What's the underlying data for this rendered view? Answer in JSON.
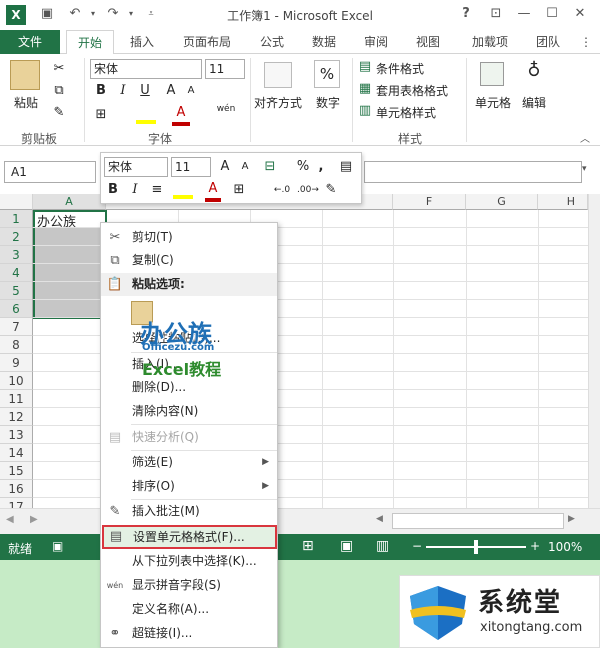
{
  "window": {
    "title": "工作簿1 - Microsoft Excel",
    "help": "?"
  },
  "ribbon_tabs": [
    "开始",
    "插入",
    "页面布局",
    "公式",
    "数据",
    "审阅",
    "视图",
    "加载项",
    "团队"
  ],
  "file_tab": "文件",
  "ribbon": {
    "clipboard": {
      "paste": "粘贴",
      "group": "剪贴板"
    },
    "font": {
      "name": "宋体",
      "size": "11",
      "group": "字体",
      "bold": "B",
      "italic": "I",
      "underline": "U",
      "phonetic": "wén"
    },
    "alignment": {
      "label": "对齐方式"
    },
    "number": {
      "label": "数字",
      "symbol": "%"
    },
    "styles": {
      "conditional": "条件格式",
      "table": "套用表格格式",
      "cell": "单元格样式",
      "group": "样式"
    },
    "cells": {
      "label": "单元格"
    },
    "editing": {
      "label": "编辑"
    }
  },
  "formula_bar": {
    "name_box": "A1",
    "fx": "fx"
  },
  "grid": {
    "columns": [
      "A",
      "B",
      "C",
      "D",
      "E",
      "F",
      "G",
      "H"
    ],
    "visible_col_labels": [
      "A",
      "F",
      "G",
      "H"
    ],
    "rows": [
      "1",
      "2",
      "3",
      "4",
      "5",
      "6",
      "7",
      "8",
      "9",
      "10",
      "11",
      "12",
      "13",
      "14",
      "15",
      "16",
      "17"
    ],
    "cell_a1": "办公族"
  },
  "mini_toolbar": {
    "font": "宋体",
    "size": "11",
    "bold": "B",
    "italic": "I",
    "percent": "%",
    "comma": ","
  },
  "context_menu": {
    "items": [
      "剪切(T)",
      "复制(C)",
      "粘贴选项:",
      "选择性粘贴(S)...",
      "插入(I)...",
      "删除(D)...",
      "清除内容(N)",
      "快速分析(Q)",
      "筛选(E)",
      "排序(O)",
      "插入批注(M)",
      "设置单元格格式(F)...",
      "从下拉列表中选择(K)...",
      "显示拼音字段(S)",
      "定义名称(A)...",
      "超链接(I)..."
    ]
  },
  "status_bar": {
    "ready": "就绪",
    "zoom": "100%",
    "minus": "−",
    "plus": "+"
  },
  "watermarks": {
    "site1_cn": "办公族",
    "site1_url": "Officezu.com",
    "site1_sub": "Excel教程",
    "site2_cn": "系统堂",
    "site2_url": "xitongtang.com"
  },
  "colors": {
    "excel_green": "#217346",
    "highlight_red": "#d9363e",
    "selection": "#c6c6c6"
  }
}
